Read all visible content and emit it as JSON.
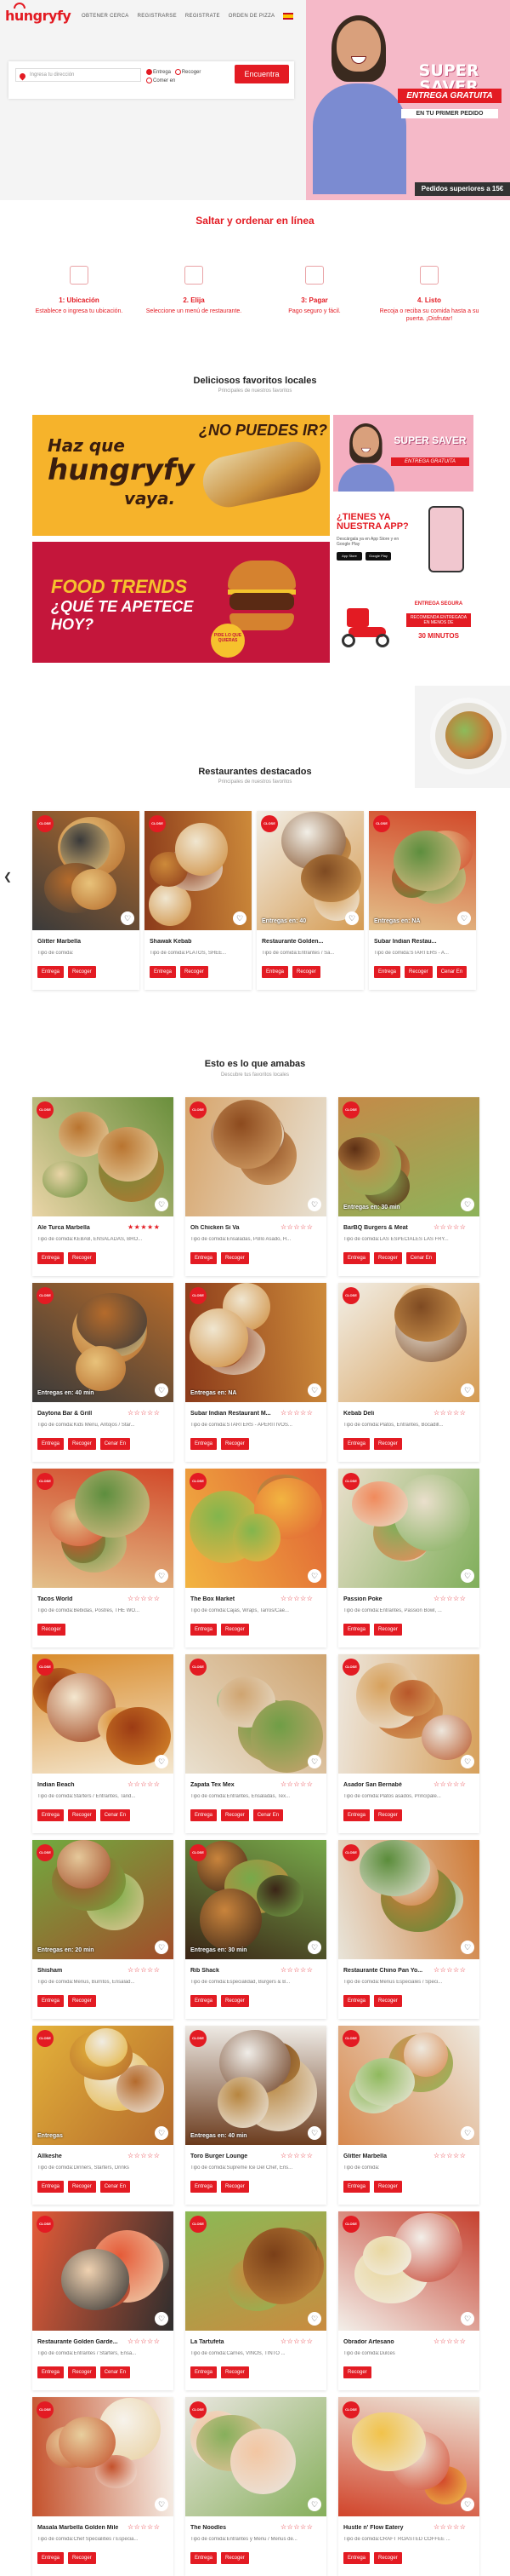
{
  "brand": {
    "logo": "hungryfy",
    "accent": "#e31b23"
  },
  "header": {
    "nav": [
      "OBTENER CERCA",
      "REGISTRARSE",
      "REGISTRATE",
      "ORDEN DE PIZZA"
    ],
    "language": "es"
  },
  "search": {
    "placeholder": "Ingresa tu dirección",
    "option_delivery": "Entrega",
    "option_pickup": "Recoger",
    "option_eatin": "Comer en",
    "button": "Encuentra"
  },
  "hero_promo": {
    "title": "SUPER SAVER",
    "subtitle": "ENTREGA GRATUITA",
    "subtitle2": "EN TU PRIMER PEDIDO",
    "footer": "Pedidos superiores a 15€"
  },
  "how_it_works": {
    "title": "Saltar y ordenar en línea",
    "steps": [
      {
        "title": "1: Ubicación",
        "desc": "Establece o ingresa tu ubicación."
      },
      {
        "title": "2. Elija",
        "desc": "Seleccione un menú de restaurante."
      },
      {
        "title": "3: Pagar",
        "desc": "Pago seguro y fácil."
      },
      {
        "title": "4. Listo",
        "desc": "Recoja o reciba su comida hasta a su puerta. ¡Disfrutar!"
      }
    ]
  },
  "favorites": {
    "title": "Deliciosos favoritos locales",
    "subtitle": "Principales de nuestros favoritos",
    "banners": {
      "hungryfy_line1": "Haz que",
      "hungryfy_line2": "hungryfy",
      "hungryfy_line3": "vaya.",
      "hungryfy_q": "¿NO PUEDES IR?",
      "trends_line1": "FOOD TRENDS",
      "trends_line2": "¿QUÉ TE APETECE HOY?",
      "trends_badge": "PIDE LO QUE QUIERAS",
      "saver_title": "SUPER SAVER",
      "saver_sub": "ENTREGA GRATUITA",
      "app_title": "¿TIENES YA NUESTRA APP?",
      "app_sub": "Descárgala ya en App Store y en Google Play",
      "app_store": "App Store",
      "google_play": "Google Play",
      "fast_title": "ENTREGA SEGURA",
      "fast_sub": "RECOMIENDA ENTREGADA EN MENOS DE",
      "fast_minutes": "30 MINUTOS"
    }
  },
  "featured": {
    "title": "Restaurantes destacados",
    "subtitle": "Principales de nuestros favoritos",
    "items": [
      {
        "name": "Glitter Marbella",
        "desc": "Tipo de comida:",
        "eta": "",
        "buttons": [
          "Entrega",
          "Recoger"
        ]
      },
      {
        "name": "Shawak Kebab",
        "desc": "Tipo de comida:PLATOS, SHEE...",
        "eta": "",
        "buttons": [
          "Entrega",
          "Recoger"
        ]
      },
      {
        "name": "Restaurante Golden...",
        "desc": "Tipo de comida:Entrantes / Sa...",
        "eta": "Entregas en: 40",
        "buttons": [
          "Entrega",
          "Recoger"
        ]
      },
      {
        "name": "Subar Indian Restau...",
        "desc": "Tipo de comida:STARTERS - A...",
        "eta": "Entregas en: NA",
        "buttons": [
          "Entrega",
          "Recoger",
          "Cenar En"
        ]
      }
    ]
  },
  "both": {
    "title": "Esto es lo que amabas",
    "subtitle": "Descubre tus favoritos locales",
    "items": [
      {
        "name": "Ale Turca Marbella",
        "desc": "Tipo de comida:KEBAB, ENSALADAS, BRO...",
        "eta": "",
        "stars": 5,
        "buttons": [
          "Entrega",
          "Recoger"
        ]
      },
      {
        "name": "Oh Chicken Si Va",
        "desc": "Tipo de comida:Ensaladas, Pollo Asado, H...",
        "eta": "",
        "stars": 0,
        "buttons": [
          "Entrega",
          "Recoger"
        ]
      },
      {
        "name": "BarBQ Burgers & Meat",
        "desc": "Tipo de comida:LAS ESPECIALES LAS FRY...",
        "eta": "Entregas en: 30 min",
        "stars": 0,
        "buttons": [
          "Entrega",
          "Recoger",
          "Cenar En"
        ]
      },
      {
        "name": "Daytona Bar & Grill",
        "desc": "Tipo de comida:Kids Menu, Antojos / Star...",
        "eta": "Entregas en: 40 min",
        "stars": 0,
        "buttons": [
          "Entrega",
          "Recoger",
          "Cenar En"
        ]
      },
      {
        "name": "Subar Indian Restaurant M...",
        "desc": "Tipo de comida:STARTERS - APERITIVOS...",
        "eta": "Entregas en: NA",
        "stars": 0,
        "buttons": [
          "Entrega",
          "Recoger"
        ]
      },
      {
        "name": "Kebab Deli",
        "desc": "Tipo de comida:Platos, Entrantes, Bocadill...",
        "eta": "",
        "stars": 0,
        "buttons": [
          "Entrega",
          "Recoger"
        ]
      },
      {
        "name": "Tacos World",
        "desc": "Tipo de comida:Bebidas, Postres, THE WO...",
        "eta": "",
        "stars": 0,
        "buttons": [
          "Recoger"
        ]
      },
      {
        "name": "The Box Market",
        "desc": "Tipo de comida:Cajas, Wraps, Tarros/Cae...",
        "eta": "",
        "stars": 0,
        "buttons": [
          "Entrega",
          "Recoger"
        ]
      },
      {
        "name": "Passion Poke",
        "desc": "Tipo de comida:Entrantes, Passion Bowl, ...",
        "eta": "",
        "stars": 0,
        "buttons": [
          "Entrega",
          "Recoger"
        ]
      },
      {
        "name": "Indian Beach",
        "desc": "Tipo de comida:Starters / Entrantes, Tand...",
        "eta": "",
        "stars": 0,
        "buttons": [
          "Entrega",
          "Recoger",
          "Cenar En"
        ]
      },
      {
        "name": "Zapata Tex Mex",
        "desc": "Tipo de comida:Entrantes, Ensaladas, Tex...",
        "eta": "",
        "stars": 0,
        "buttons": [
          "Entrega",
          "Recoger",
          "Cenar En"
        ]
      },
      {
        "name": "Asador San Bernabé",
        "desc": "Tipo de comida:Platos asados, Principale...",
        "eta": "",
        "stars": 0,
        "buttons": [
          "Entrega",
          "Recoger"
        ]
      },
      {
        "name": "Shisham",
        "desc": "Tipo de comida:Menus, Burritos, Ensalad...",
        "eta": "Entregas en: 20 min",
        "stars": 0,
        "buttons": [
          "Entrega",
          "Recoger"
        ]
      },
      {
        "name": "Rib Shack",
        "desc": "Tipo de comida:Especialidad, Burgers & B...",
        "eta": "Entregas en: 30 min",
        "stars": 0,
        "buttons": [
          "Entrega",
          "Recoger"
        ]
      },
      {
        "name": "Restaurante Chino Pan Yo...",
        "desc": "Tipo de comida:Menus Especiales / Speci...",
        "eta": "",
        "stars": 0,
        "buttons": [
          "Entrega",
          "Recoger"
        ]
      },
      {
        "name": "Allkeshe",
        "desc": "Tipo de comida:Dinners, Starters, Drinks",
        "eta": "Entregas",
        "stars": 0,
        "buttons": [
          "Entrega",
          "Recoger",
          "Cenar En"
        ]
      },
      {
        "name": "Toro Burger Lounge",
        "desc": "Tipo de comida:Supreme Ice Del Chef, Ens...",
        "eta": "Entregas en: 40 min",
        "stars": 0,
        "buttons": [
          "Entrega",
          "Recoger"
        ]
      },
      {
        "name": "Glitter Marbella",
        "desc": "Tipo de comida:",
        "eta": "",
        "stars": 0,
        "buttons": [
          "Entrega",
          "Recoger"
        ]
      },
      {
        "name": "Restaurante Golden Garde...",
        "desc": "Tipo de comida:Entrantes / Starters, Ensa...",
        "eta": "",
        "stars": 0,
        "buttons": [
          "Entrega",
          "Recoger",
          "Cenar En"
        ]
      },
      {
        "name": "La Tartufeta",
        "desc": "Tipo de comida:Carnes, VINOS, TINTO ...",
        "eta": "",
        "stars": 0,
        "buttons": [
          "Entrega",
          "Recoger"
        ]
      },
      {
        "name": "Obrador Artesano",
        "desc": "Tipo de comida:Dulces",
        "eta": "",
        "stars": 0,
        "buttons": [
          "Recoger"
        ]
      },
      {
        "name": "Masala Marbella Golden Mile",
        "desc": "Tipo de comida:Chef Specialities / Especia...",
        "eta": "",
        "stars": 0,
        "buttons": [
          "Entrega",
          "Recoger"
        ]
      },
      {
        "name": "The Noodles",
        "desc": "Tipo de comida:Entrantes y Menu / Menus de...",
        "eta": "",
        "stars": 0,
        "buttons": [
          "Entrega",
          "Recoger"
        ]
      },
      {
        "name": "Hustle n' Flow Eatery",
        "desc": "Tipo de comida:CRAFT ROASTED COFFEE ...",
        "eta": "",
        "stars": 0,
        "buttons": [
          "Entrega",
          "Recoger"
        ]
      }
    ]
  },
  "card_badge": "CLOSE"
}
